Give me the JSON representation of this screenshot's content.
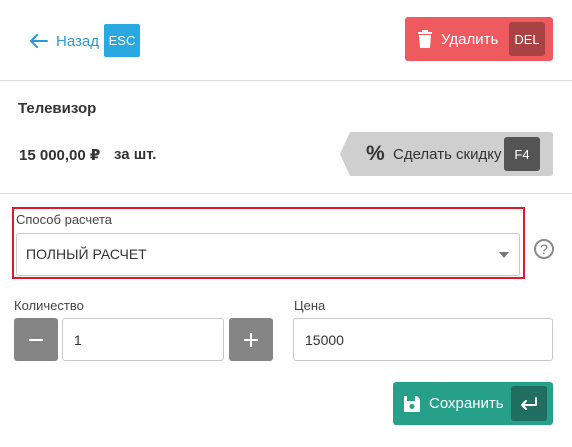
{
  "header": {
    "back_label": "Назад",
    "back_shortcut": "ESC",
    "delete_label": "Удалить",
    "delete_shortcut": "DEL"
  },
  "product": {
    "name": "Телевизор",
    "price": "15 000,00 ₽",
    "unit_note": "за шт."
  },
  "discount": {
    "icon_text": "%",
    "label": "Сделать скидку",
    "shortcut": "F4"
  },
  "payment_method": {
    "label": "Способ расчета",
    "selected": "ПОЛНЫЙ РАСЧЕТ",
    "help_text": "?"
  },
  "quantity": {
    "label": "Количество",
    "value": "1",
    "decrement_icon": "minus-icon",
    "increment_icon": "plus-icon"
  },
  "price_field": {
    "label": "Цена",
    "value": "15000"
  },
  "save": {
    "label": "Сохранить",
    "shortcut_icon": "enter-icon"
  },
  "colors": {
    "accent_blue": "#2aa8e0",
    "delete_red": "#ef5a5f",
    "save_green": "#27a08a",
    "highlight_red": "#e0182d"
  }
}
